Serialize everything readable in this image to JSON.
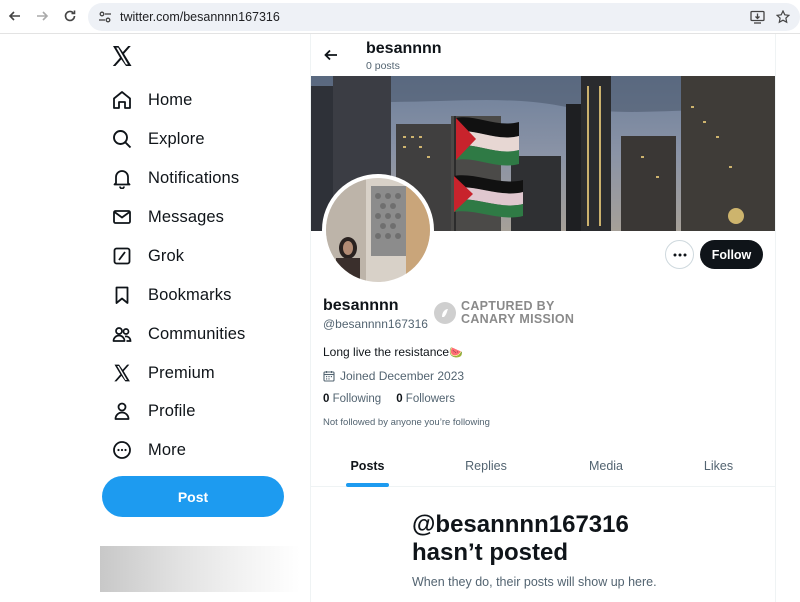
{
  "browser": {
    "url": "twitter.com/besannnn167316"
  },
  "sidebar": {
    "items": [
      {
        "label": "Home",
        "icon": "home-icon"
      },
      {
        "label": "Explore",
        "icon": "search-icon"
      },
      {
        "label": "Notifications",
        "icon": "bell-icon"
      },
      {
        "label": "Messages",
        "icon": "mail-icon"
      },
      {
        "label": "Grok",
        "icon": "grok-icon"
      },
      {
        "label": "Bookmarks",
        "icon": "bookmark-icon"
      },
      {
        "label": "Communities",
        "icon": "communities-icon"
      },
      {
        "label": "Premium",
        "icon": "x-logo-icon"
      },
      {
        "label": "Profile",
        "icon": "person-icon"
      },
      {
        "label": "More",
        "icon": "more-circle-icon"
      }
    ],
    "post_label": "Post"
  },
  "header": {
    "name": "besannnn",
    "post_count": "0 posts"
  },
  "profile": {
    "name": "besannnn",
    "handle": "@besannnn167316",
    "bio": "Long live the resistance",
    "bio_emoji": "🍉",
    "joined": "Joined December 2023",
    "following_count": "0",
    "following_label": "Following",
    "followers_count": "0",
    "followers_label": "Followers",
    "not_followed": "Not followed by anyone you’re following",
    "follow_label": "Follow",
    "stamp_line1": "CAPTURED BY",
    "stamp_line2": "CANARY MISSION"
  },
  "tabs": [
    {
      "label": "Posts",
      "active": true
    },
    {
      "label": "Replies",
      "active": false
    },
    {
      "label": "Media",
      "active": false
    },
    {
      "label": "Likes",
      "active": false
    }
  ],
  "empty_state": {
    "title_line1": "@besannnn167316",
    "title_line2": "hasn’t posted",
    "subtitle": "When they do, their posts will show up here."
  },
  "colors": {
    "accent": "#1d9bf0",
    "text": "#0f1419",
    "muted": "#536471",
    "follow_bg": "#0f1419"
  }
}
